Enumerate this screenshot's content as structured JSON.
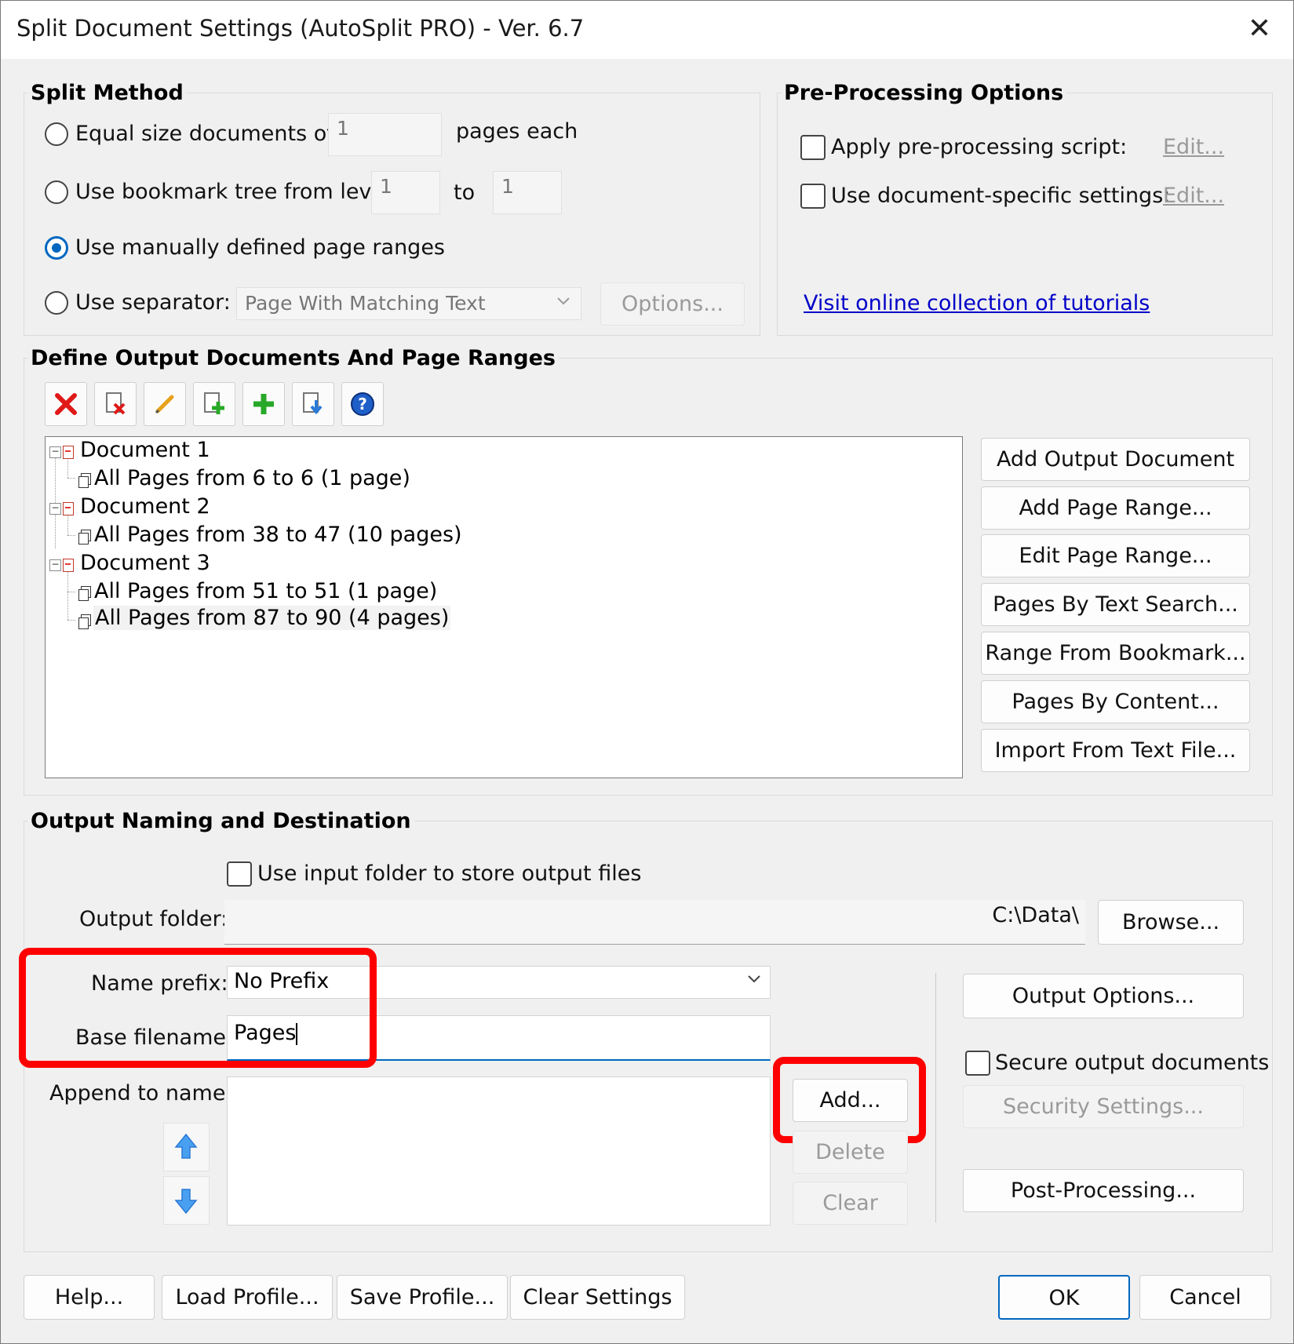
{
  "window": {
    "title": "Split Document Settings (AutoSplit PRO) - Ver. 6.7",
    "close_symbol": "✕"
  },
  "split_method": {
    "heading": "Split Method",
    "equal_size": {
      "label": "Equal size documents of",
      "value": "1",
      "suffix": "pages each"
    },
    "bookmark": {
      "label": "Use bookmark tree from level",
      "from": "1",
      "to_label": "to",
      "to": "1"
    },
    "manual": {
      "label": "Use manually defined page ranges"
    },
    "separator": {
      "label": "Use separator:",
      "value": "Page With Matching Text",
      "options_button": "Options..."
    }
  },
  "preprocessing": {
    "heading": "Pre-Processing Options",
    "script": {
      "label": "Apply pre-processing script:",
      "edit": "Edit..."
    },
    "doc_specific": {
      "label": "Use document-specific settings:",
      "edit": "Edit..."
    },
    "tutorials_link": "Visit online collection of tutorials"
  },
  "define_output": {
    "heading": "Define Output Documents And Page Ranges",
    "toolbar_icons": [
      "delete-icon",
      "delete-document-icon",
      "edit-pencil-icon",
      "add-page-icon",
      "add-plus-icon",
      "import-icon",
      "help-icon"
    ],
    "tree": [
      {
        "label": "Document 1",
        "ranges": [
          "All Pages from 6 to 6 (1 page)"
        ]
      },
      {
        "label": "Document 2",
        "ranges": [
          "All Pages from 38 to 47 (10 pages)"
        ]
      },
      {
        "label": "Document 3",
        "ranges": [
          "All Pages from 51 to 51 (1 page)",
          "All Pages from 87 to 90 (4 pages)"
        ]
      }
    ],
    "buttons": [
      "Add Output Document",
      "Add Page Range...",
      "Edit Page Range...",
      "Pages By Text Search...",
      "Range From Bookmark...",
      "Pages By Content...",
      "Import From Text File..."
    ]
  },
  "output_naming": {
    "heading": "Output Naming and Destination",
    "use_input_folder": "Use input folder to store output files",
    "output_folder_label": "Output folder:",
    "output_folder_value": "C:\\Data\\",
    "browse": "Browse...",
    "name_prefix_label": "Name prefix:",
    "name_prefix_value": "No Prefix",
    "base_filename_label": "Base filename:",
    "base_filename_value": "Pages",
    "append_label": "Append to name:",
    "add_button": "Add...",
    "delete_button": "Delete",
    "clear_button": "Clear",
    "output_options": "Output Options...",
    "secure_label": "Secure output documents",
    "security_settings": "Security Settings...",
    "post_processing": "Post-Processing..."
  },
  "footer": {
    "help": "Help...",
    "load_profile": "Load Profile...",
    "save_profile": "Save Profile...",
    "clear_settings": "Clear Settings",
    "ok": "OK",
    "cancel": "Cancel"
  },
  "colors": {
    "accent": "#0067c0",
    "highlight_box": "#ff0000",
    "link": "#0000c8"
  }
}
